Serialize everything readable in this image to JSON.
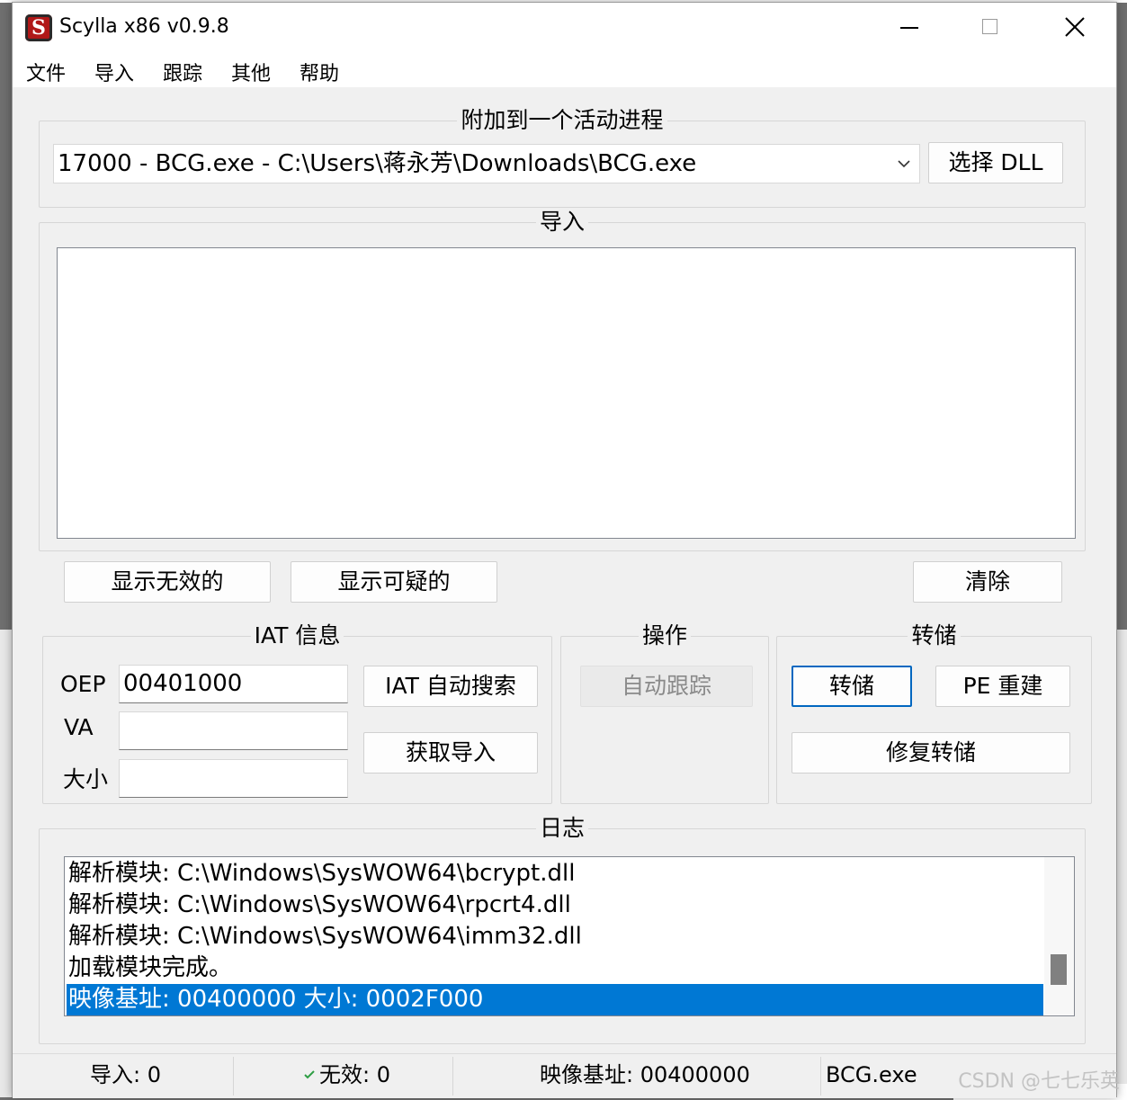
{
  "window": {
    "title": "Scylla x86 v0.9.8",
    "icon_letter": "S"
  },
  "menu": [
    "文件",
    "导入",
    "跟踪",
    "其他",
    "帮助"
  ],
  "attach": {
    "title": "附加到一个活动进程",
    "process_selected": "17000 - BCG.exe - C:\\Users\\蒋永芳\\Downloads\\BCG.exe",
    "select_dll_label": "选择 DLL"
  },
  "imports": {
    "title": "导入",
    "show_invalid_label": "显示无效的",
    "show_suspect_label": "显示可疑的",
    "clear_label": "清除"
  },
  "iat": {
    "title": "IAT 信息",
    "oep_label": "OEP",
    "oep_value": "00401000",
    "va_label": "VA",
    "va_value": "",
    "size_label": "大小",
    "size_value": "",
    "autosearch_label": "IAT 自动搜索",
    "get_imports_label": "获取导入"
  },
  "actions": {
    "title": "操作",
    "autotrace_label": "自动跟踪"
  },
  "dump": {
    "title": "转储",
    "dump_label": "转储",
    "pe_rebuild_label": "PE 重建",
    "fix_dump_label": "修复转储"
  },
  "log": {
    "title": "日志",
    "lines": [
      "解析模块: C:\\Windows\\SysWOW64\\bcrypt.dll",
      "解析模块: C:\\Windows\\SysWOW64\\rpcrt4.dll",
      "解析模块: C:\\Windows\\SysWOW64\\imm32.dll",
      "加载模块完成。",
      "映像基址: 00400000 大小: 0002F000"
    ]
  },
  "status": {
    "imports": "导入: 0",
    "invalid": "无效: 0",
    "imagebase": "映像基址: 00400000",
    "module": "BCG.exe"
  },
  "watermark": "CSDN @七七乐英",
  "colors": {
    "selection": "#0078d4",
    "focus_border": "#0067c0",
    "valid_check": "#2e9e44"
  }
}
